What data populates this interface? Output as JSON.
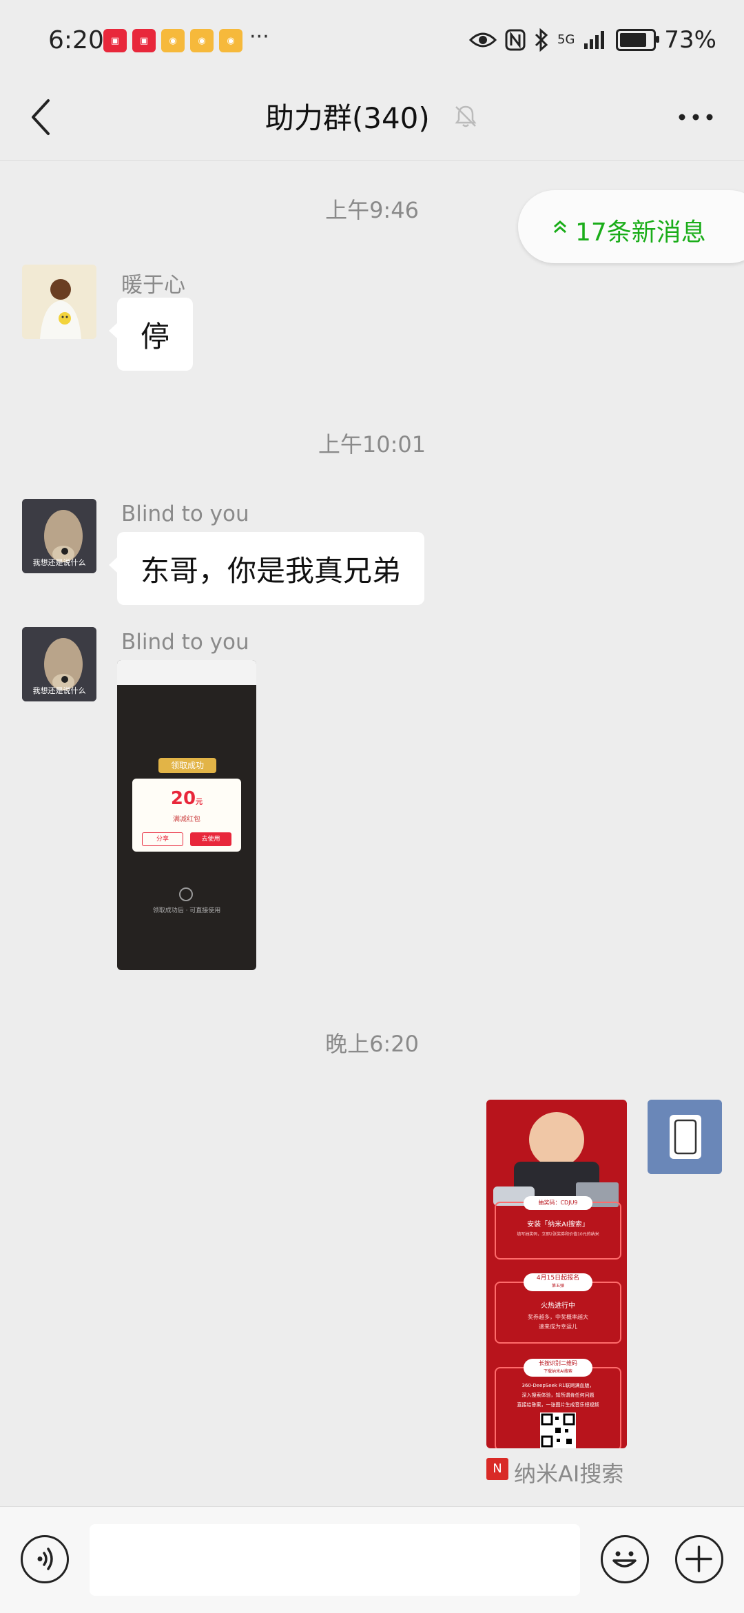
{
  "status_bar": {
    "time": "6:20",
    "app_icons": [
      "hongbao-app-icon",
      "hongbao-app-icon",
      "weibo-icon",
      "weibo-icon",
      "weibo-icon"
    ],
    "more": "···",
    "battery": "73%",
    "battery_level": 0.73,
    "network": "5G"
  },
  "header": {
    "title": "助力群(340)"
  },
  "new_messages": {
    "label": "17条新消息",
    "accent": "#1aad19"
  },
  "messages": [
    {
      "type": "time",
      "text": "上午9:46"
    },
    {
      "type": "text",
      "sender": "暖于心",
      "text": "停"
    },
    {
      "type": "time",
      "text": "上午10:01"
    },
    {
      "type": "text",
      "sender": "Blind to you",
      "avatar_caption": "我想还是说什么",
      "text": "东哥，你是我真兄弟"
    },
    {
      "type": "image",
      "sender": "Blind to you",
      "avatar_caption": "我想还是说什么",
      "image_texts": {
        "banner": "领取成功",
        "amount": "20",
        "unit": "元",
        "sub": "满减红包",
        "btn_left": "分享",
        "btn_right": "去使用",
        "footer": "领取成功后 · 可直接使用"
      }
    },
    {
      "type": "time",
      "text": "晚上6:20"
    },
    {
      "type": "image_self",
      "image_texts": {
        "code_label": "抽奖码：CDJU9",
        "install": "安装「纳米AI搜索」",
        "install_sub": "填写抽奖码，立即2张奖券和价值10元的纳米",
        "date_title": "4月15日起报名",
        "date_sub": "第五弹",
        "hot": "火热进行中",
        "hot_sub1": "奖券越多，中奖概率越大",
        "hot_sub2": "速来成为幸运儿",
        "qr_title": "长按识别二维码",
        "qr_sub": "下载纳米AI搜索",
        "ds1": "360-DeepSeek R1联网满血版，",
        "ds2": "深入搜索体验，知所谓肯任何问题",
        "ds3": "直接给答案，一张图片生成音乐短视频"
      },
      "source_label": "纳米AI搜索"
    }
  ]
}
